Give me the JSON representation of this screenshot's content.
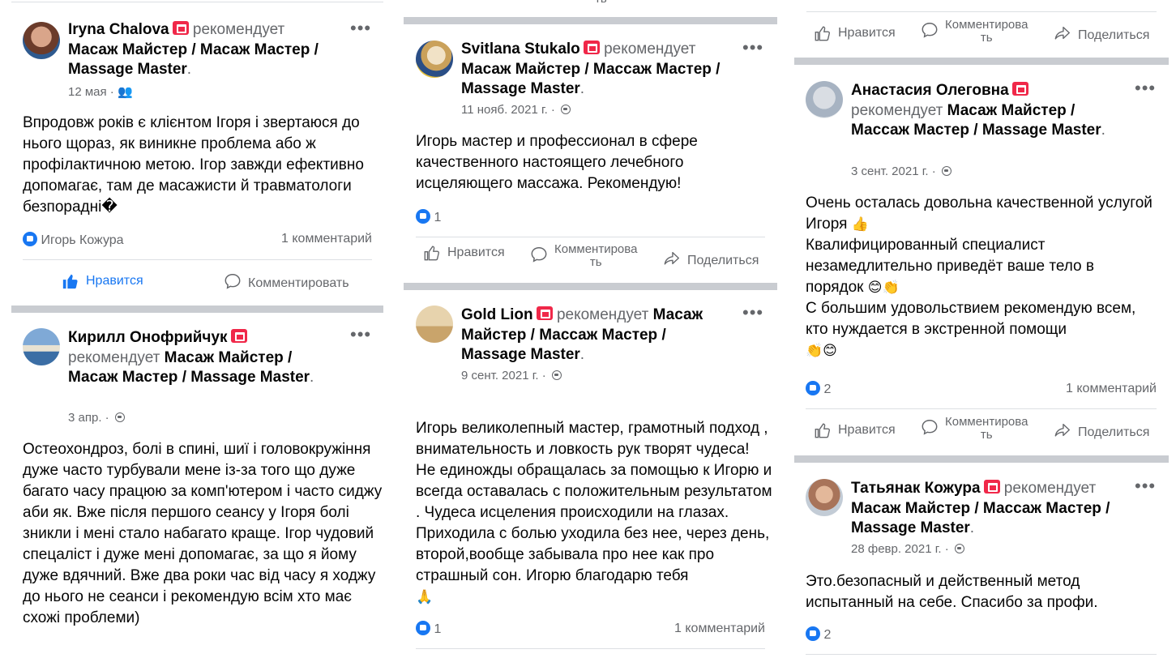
{
  "labels": {
    "recommends": "рекомендует",
    "like": "Нравится",
    "comment": "Комментировать",
    "comment_split_a": "Комментирова",
    "comment_split_b": "ть",
    "share": "Поделиться"
  },
  "posts": {
    "iryna": {
      "author": "Iryna Chalova",
      "page": "Масаж Майстер / Масаж Мастер / Massage Master",
      "date": "12 мая",
      "text": "Впродовж років є клієнтом Ігоря і звертаюся до нього щораз, як виникне проблема або ж профілактичною метою. Ігор завжди ефективно допомагає, там де масажисти й травматологи безпорадні�",
      "reaction_name": "Игорь Кожура",
      "comments": "1 комментарий"
    },
    "kirill": {
      "author": "Кирилл Онофрийчук",
      "page": "Масаж Майстер / Масаж Мастер / Massage Master",
      "date": "3 апр.",
      "text": "Остеохондроз, болі в спині, шиї і головокружіння дуже часто турбували мене із-за того що дуже багато часу працюю за комп'ютером і часто сиджу аби як. Вже після першого сеансу у Ігоря болі зникли і мені стало набагато краще. Ігор чудовий спецаліст і дуже мені допомагає, за що я йому дуже вдячний. Вже два роки час від часу я ходжу до нього не сеанси і рекомендую всім хто має схожі проблеми)"
    },
    "svitlana": {
      "author": "Svitlana Stukalo",
      "page": "Масаж Майстер / Массаж Мастер / Massage Master",
      "date": "11 нояб. 2021 г.",
      "text": "Игорь мастер и профессионал в сфере качественного настоящего лечебного исцеляющего массажа. Рекомендую!",
      "likes": "1"
    },
    "goldlion": {
      "author": "Gold Lion",
      "page": "Масаж Майстер / Массаж Мастер / Massage Master",
      "date": "9 сент. 2021 г.",
      "text": "Игорь великолепный мастер, грамотный подход , внимательность и ловкость рук творят чудеса! Не единожды обращалась за помощью к Игорю  и всегда оставалась с положительным результатом . Чудеса исцеления происходили  на глазах. Приходила с болью уходила без нее, через день, второй,вообще забывала про нее как про страшный сон.  Игорю благодарю тебя",
      "likes": "1",
      "comments": "1 комментарий"
    },
    "anastasia": {
      "author": "Анастасия Олеговна",
      "page": "Масаж Майстер / Массаж Мастер / Massage Master",
      "date": "3 сент. 2021 г.",
      "text_1": "Очень осталась довольна качественной услугой Игоря",
      "text_2": "Квалифицированный специалист незамедлительно приведёт ваше тело в порядок",
      "text_3": "С большим удовольствием рекомендую всем, кто нуждается в экстренной помощи",
      "likes": "2",
      "comments": "1 комментарий"
    },
    "tatyana": {
      "author": "Татьянак Кожура",
      "page": "Масаж Майстер / Массаж Мастер / Massage Master",
      "date": "28 февр. 2021 г.",
      "text": "Это.безопасный и действенный метод испытанный на себе. Спасибо за профи.",
      "likes": "2"
    }
  },
  "cutoff": {
    "top_left": "",
    "top_mid": "ть"
  }
}
